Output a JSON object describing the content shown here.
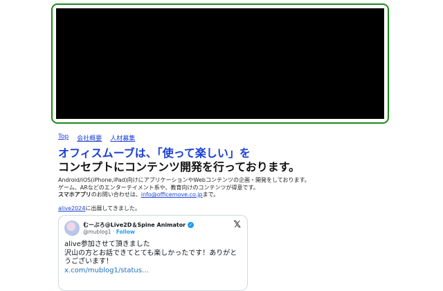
{
  "banner": {
    "frame_color": "#1a8a1a",
    "content_color": "#000000"
  },
  "nav": [
    {
      "label": "Top"
    },
    {
      "label": "会社概要"
    },
    {
      "label": "人材募集"
    }
  ],
  "headline": {
    "line1": "オフィスムーブは、「使って楽しい」を",
    "line2": "コンセプトにコンテンツ開発を行っております。",
    "accent_color": "#1a3fd6"
  },
  "description": {
    "line1": "Android/iOS(iPhone,iPad)向けにアプリケーションやWebコンテンツの企画・開発をしております。",
    "line2": "ゲーム、ARなどのエンターテイメント系や、教育向けのコンテンツが得意です。",
    "line3_bold": "スマホアプリ",
    "line3_mid": "のお問い合わせは、",
    "email": "info@officemove.co.jp",
    "line3_end": "まで。"
  },
  "notice": {
    "link": "alive2024",
    "text": "に出展してきました。"
  },
  "tweet": {
    "author_name": "むーぶろ@Live2D＆Spine Animator",
    "handle": "@mublog1",
    "separator": "·",
    "follow_label": "Follow",
    "verified_icon": "verified-badge-icon",
    "platform_icon": "x-logo-icon",
    "line1": "alive参加させて頂きました",
    "line2": "沢山の方とお話できてとても楽しかったです！ありがと",
    "line3": "うございます！",
    "link": "x.com/mublog1/status…"
  }
}
